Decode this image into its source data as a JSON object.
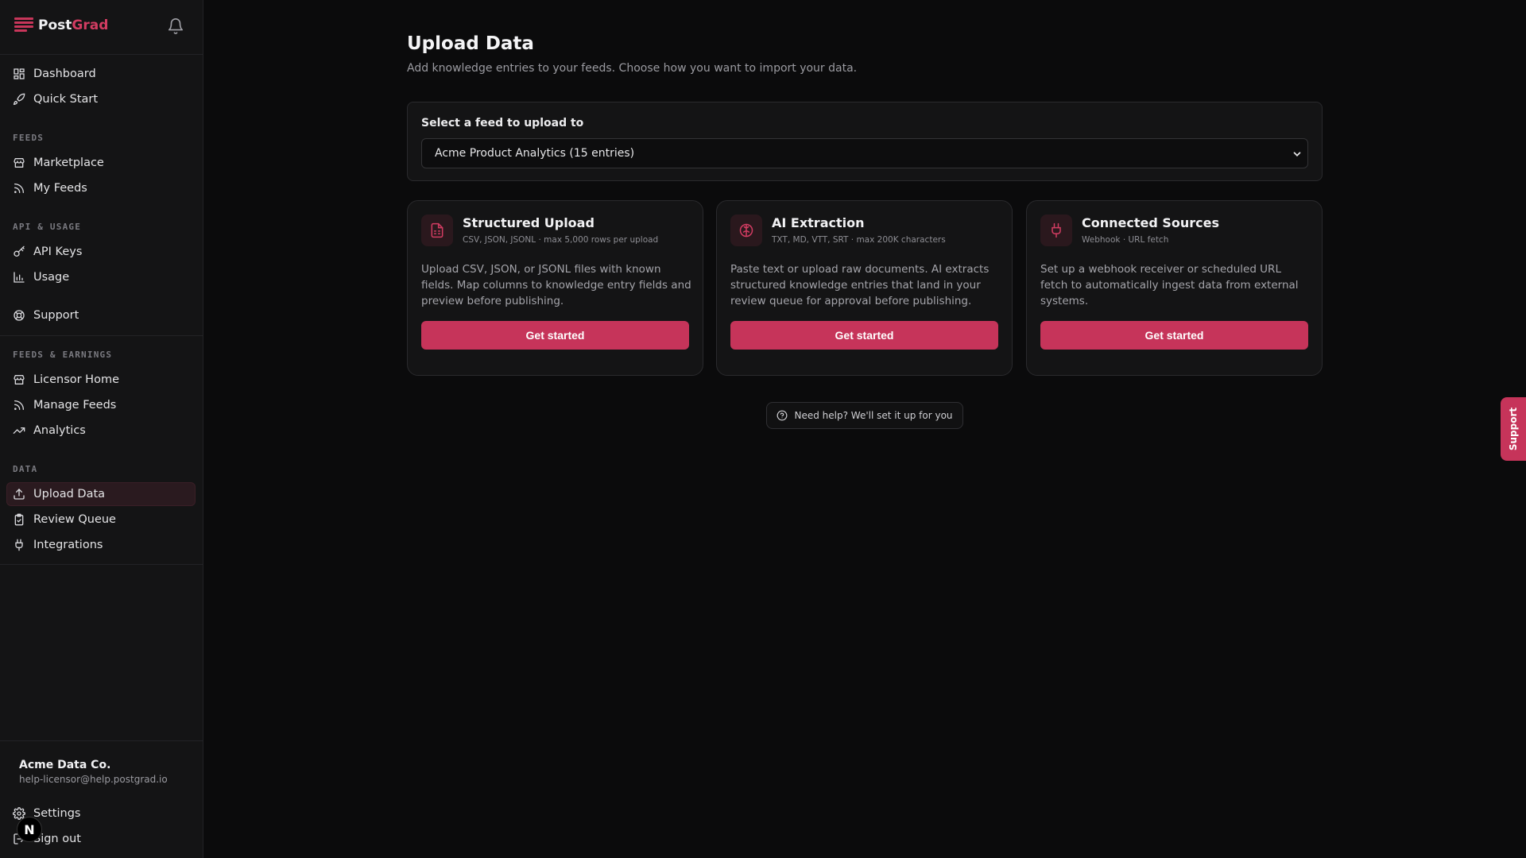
{
  "brand": {
    "part1": "Post",
    "part2": "Grad"
  },
  "sidebar": {
    "top_items": [
      {
        "label": "Dashboard",
        "icon": "dashboard-icon"
      },
      {
        "label": "Quick Start",
        "icon": "rocket-icon"
      }
    ],
    "sections": [
      {
        "label": "FEEDS",
        "items": [
          {
            "label": "Marketplace",
            "icon": "store-icon"
          },
          {
            "label": "My Feeds",
            "icon": "rss-icon"
          }
        ]
      },
      {
        "label": "API & USAGE",
        "items": [
          {
            "label": "API Keys",
            "icon": "key-icon"
          },
          {
            "label": "Usage",
            "icon": "bar-chart-icon"
          }
        ]
      },
      {
        "label": "FEEDS & EARNINGS",
        "items": [
          {
            "label": "Licensor Home",
            "icon": "store-icon"
          },
          {
            "label": "Manage Feeds",
            "icon": "rss-icon"
          },
          {
            "label": "Analytics",
            "icon": "trending-up-icon"
          }
        ]
      },
      {
        "label": "DATA",
        "items": [
          {
            "label": "Upload Data",
            "icon": "upload-icon",
            "active": true
          },
          {
            "label": "Review Queue",
            "icon": "clipboard-check-icon"
          },
          {
            "label": "Integrations",
            "icon": "plug-icon"
          }
        ]
      }
    ],
    "support": {
      "label": "Support",
      "icon": "lifebuoy-icon"
    },
    "account": {
      "name": "Acme Data Co.",
      "email": "help-licensor@help.postgrad.io"
    },
    "settings": {
      "label": "Settings",
      "icon": "gear-icon"
    },
    "signout": {
      "label": "Sign out",
      "icon": "sign-out-icon"
    },
    "badge": "N"
  },
  "main": {
    "title": "Upload Data",
    "subtitle": "Add knowledge entries to your feeds. Choose how you want to import your data.",
    "feed_select": {
      "label": "Select a feed to upload to",
      "value": "Acme Product Analytics (15 entries)"
    },
    "cards": [
      {
        "title": "Structured Upload",
        "meta": "CSV, JSON, JSONL · max 5,000 rows per upload",
        "description": "Upload CSV, JSON, or JSONL files with known fields. Map columns to knowledge entry fields and preview before publishing.",
        "button": "Get started",
        "icon": "file-spreadsheet-icon"
      },
      {
        "title": "AI Extraction",
        "meta": "TXT, MD, VTT, SRT · max 200K characters",
        "description": "Paste text or upload raw documents. AI extracts structured knowledge entries that land in your review queue for approval before publishing.",
        "button": "Get started",
        "icon": "brain-icon"
      },
      {
        "title": "Connected Sources",
        "meta": "Webhook · URL fetch",
        "description": "Set up a webhook receiver or scheduled URL fetch to automatically ingest data from external systems.",
        "button": "Get started",
        "icon": "plug-icon"
      }
    ],
    "help": "Need help? We'll set it up for you"
  },
  "support_tab": "Support",
  "colors": {
    "accent": "#c6345a",
    "background": "#0b0b0c",
    "sidebar": "#141415"
  }
}
